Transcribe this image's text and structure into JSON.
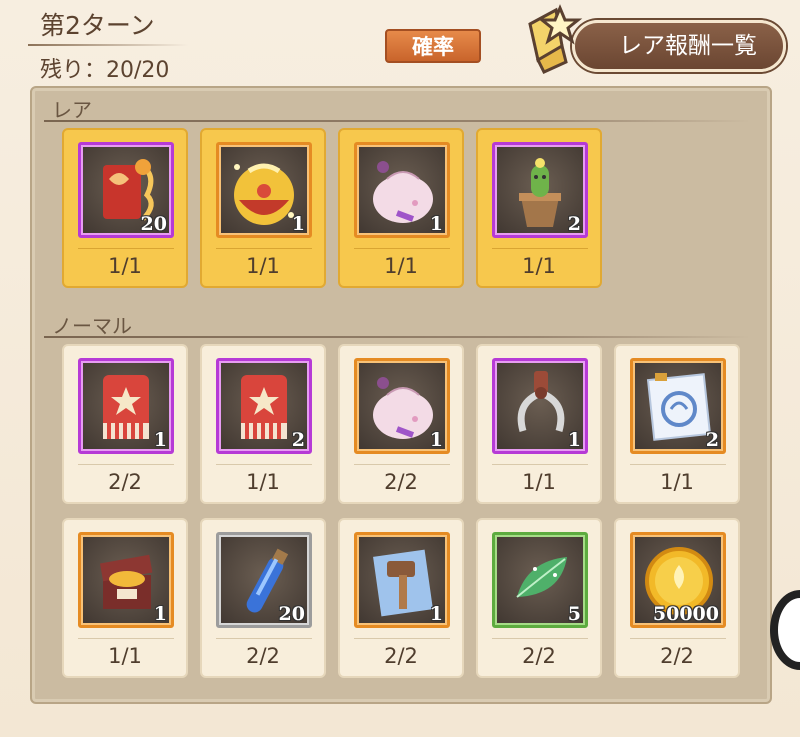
{
  "header": {
    "turn_label": "第2ターン",
    "remaining_label": "残り：20/20",
    "probability_button": "確率",
    "rare_rewards_button": "レア報酬一覧"
  },
  "sections": {
    "rare_label": "レア",
    "normal_label": "ノーマル"
  },
  "rare_items": [
    {
      "icon": "red-scroll-icon",
      "qty": "20",
      "count": "1/1",
      "frame": "purple"
    },
    {
      "icon": "golden-pouch-icon",
      "qty": "1",
      "count": "1/1",
      "frame": "orange"
    },
    {
      "icon": "pink-pouch-icon",
      "qty": "1",
      "count": "1/1",
      "frame": "orange"
    },
    {
      "icon": "cactus-pot-icon",
      "qty": "2",
      "count": "1/1",
      "frame": "purple"
    }
  ],
  "normal_items": [
    {
      "icon": "red-star-pack-icon",
      "qty": "1",
      "count": "2/2",
      "frame": "purple"
    },
    {
      "icon": "red-star-pack-icon",
      "qty": "2",
      "count": "1/1",
      "frame": "purple"
    },
    {
      "icon": "pink-pouch-icon",
      "qty": "1",
      "count": "2/2",
      "frame": "orange"
    },
    {
      "icon": "claw-icon",
      "qty": "1",
      "count": "1/1",
      "frame": "purple"
    },
    {
      "icon": "wind-scroll-icon",
      "qty": "2",
      "count": "1/1",
      "frame": "orange"
    },
    {
      "icon": "treasure-box-icon",
      "qty": "1",
      "count": "1/1",
      "frame": "orange"
    },
    {
      "icon": "blue-vial-icon",
      "qty": "20",
      "count": "2/2",
      "frame": "gray"
    },
    {
      "icon": "hammer-scroll-icon",
      "qty": "1",
      "count": "2/2",
      "frame": "orange"
    },
    {
      "icon": "green-leaf-icon",
      "qty": "5",
      "count": "2/2",
      "frame": "green"
    },
    {
      "icon": "gold-coin-icon",
      "qty": "50000",
      "count": "2/2",
      "frame": "orange"
    }
  ]
}
